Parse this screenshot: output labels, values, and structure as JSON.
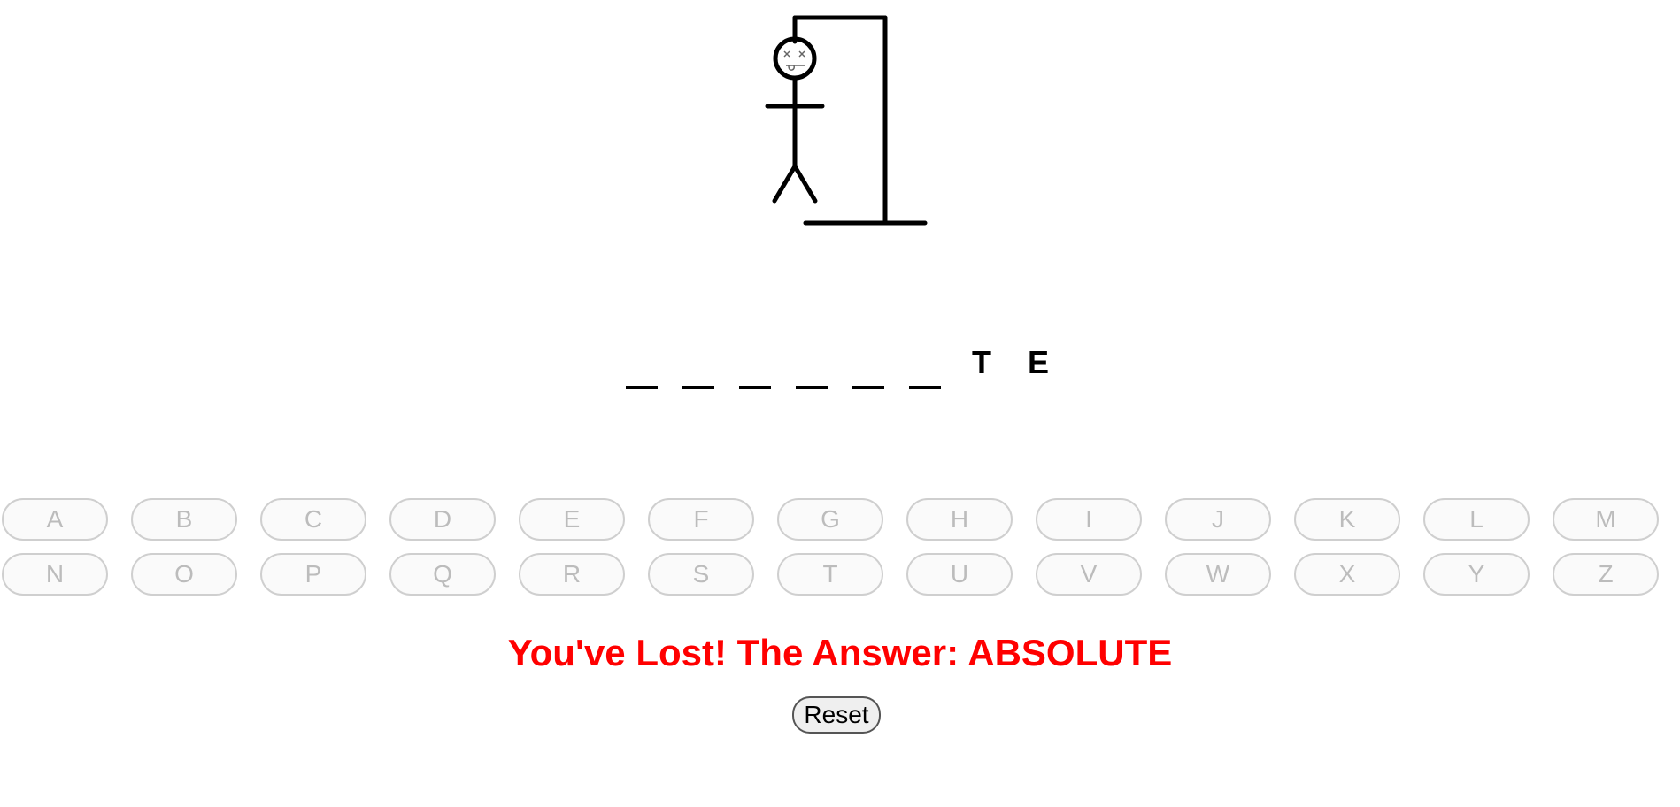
{
  "word": {
    "letters": [
      "",
      "",
      "",
      "",
      "",
      "",
      "T",
      "E"
    ]
  },
  "keyboard": {
    "rows": [
      [
        "A",
        "B",
        "C",
        "D",
        "E",
        "F",
        "G",
        "H",
        "I",
        "J",
        "K",
        "L",
        "M"
      ],
      [
        "N",
        "O",
        "P",
        "Q",
        "R",
        "S",
        "T",
        "U",
        "V",
        "W",
        "X",
        "Y",
        "Z"
      ]
    ]
  },
  "result": {
    "message": "You've Lost! The Answer: ABSOLUTE"
  },
  "controls": {
    "reset_label": "Reset"
  },
  "colors": {
    "result_text": "#ff0000",
    "key_disabled_text": "#bcbcbc"
  }
}
